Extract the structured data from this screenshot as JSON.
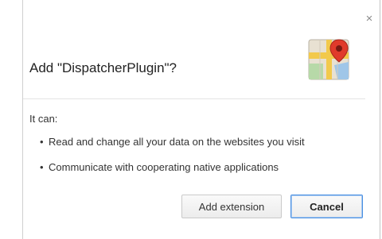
{
  "dialog": {
    "title": "Add \"DispatcherPlugin\"?",
    "close_glyph": "×",
    "icon": "maps-icon",
    "permissions_heading": "It can:",
    "permissions": [
      "Read and change all your data on the websites you visit",
      "Communicate with cooperating native applications"
    ],
    "bullet": "•",
    "buttons": {
      "add_label": "Add extension",
      "cancel_label": "Cancel"
    }
  },
  "colors": {
    "accent_border": "#4a90e2",
    "map_pin": "#e03a2b"
  }
}
